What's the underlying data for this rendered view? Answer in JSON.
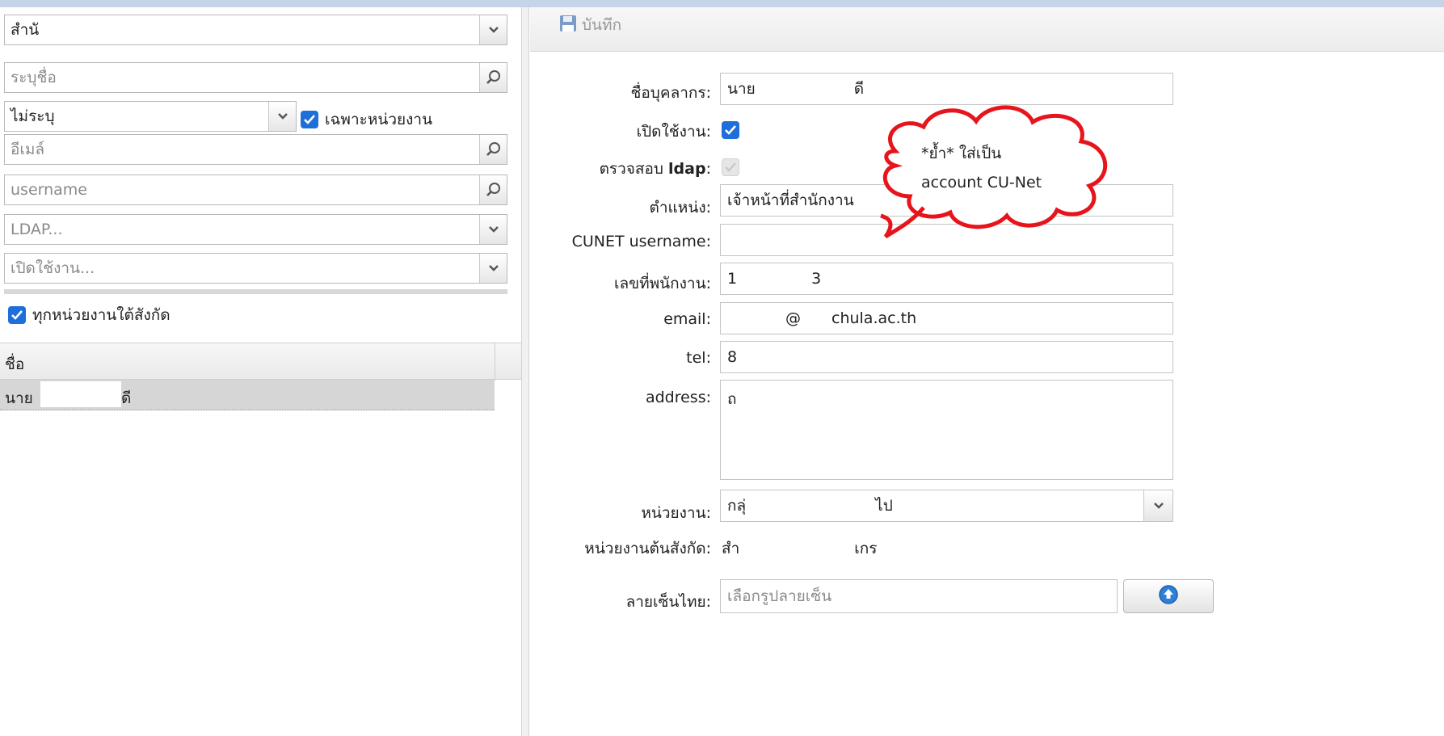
{
  "left": {
    "org_select": {
      "value": "สำนั"
    },
    "name_search": {
      "placeholder": "ระบุชื่อ"
    },
    "status_select": {
      "value": "ไม่ระบุ"
    },
    "only_unit": {
      "label": "เฉพาะหน่วยงาน",
      "checked": true
    },
    "email_search": {
      "placeholder": "อีเมล์"
    },
    "username_search": {
      "placeholder": "username"
    },
    "ldap_select": {
      "placeholder": "LDAP..."
    },
    "enabled_select": {
      "placeholder": "เปิดใช้งาน..."
    },
    "all_subunits": {
      "label": "ทุกหน่วยงานใต้สังกัด",
      "checked": true
    },
    "grid": {
      "header": "ชื่อ",
      "rows": [
        {
          "name_prefix": "นาย",
          "name_suffix": "ดี"
        }
      ]
    }
  },
  "toolbar": {
    "save_label": "บันทึก"
  },
  "form": {
    "name": {
      "label": "ชื่อบุคลากร:",
      "value_prefix": "นาย",
      "value_suffix": "ดี"
    },
    "enabled": {
      "label": "เปิดใช้งาน:",
      "checked": true
    },
    "ldap_check": {
      "label_prefix": "ตรวจสอบ ",
      "label_bold": "ldap",
      "label_suffix": ":",
      "checked": true
    },
    "position": {
      "label": "ตำแหน่ง:",
      "value": "เจ้าหน้าที่สำนักงาน"
    },
    "cunet": {
      "label": "CUNET username:",
      "value": ""
    },
    "employee_id": {
      "label": "เลขที่พนักงาน:",
      "value_a": "1",
      "value_b": "3"
    },
    "email": {
      "label": "email:",
      "value_at": "@",
      "value_domain": "chula.ac.th"
    },
    "tel": {
      "label": "tel:",
      "value": "8"
    },
    "address": {
      "label": "address:",
      "value": "ถ"
    },
    "unit": {
      "label": "หน่วยงาน:",
      "value_prefix": "กลุ่",
      "value_suffix": "ไป"
    },
    "parent_unit": {
      "label": "หน่วยงานต้นสังกัด:",
      "value_prefix": "สำ",
      "value_suffix": "เกร"
    },
    "signature": {
      "label": "ลายเซ็นไทย:",
      "placeholder": "เลือกรูปลายเซ็น"
    }
  },
  "callout": {
    "line1": "*ย้ำ* ใส่เป็น",
    "line2": "account CU-Net",
    "color": "#e8141c"
  },
  "colors": {
    "accent": "#1e6fd9",
    "selected_row": "#d6d6d6"
  }
}
